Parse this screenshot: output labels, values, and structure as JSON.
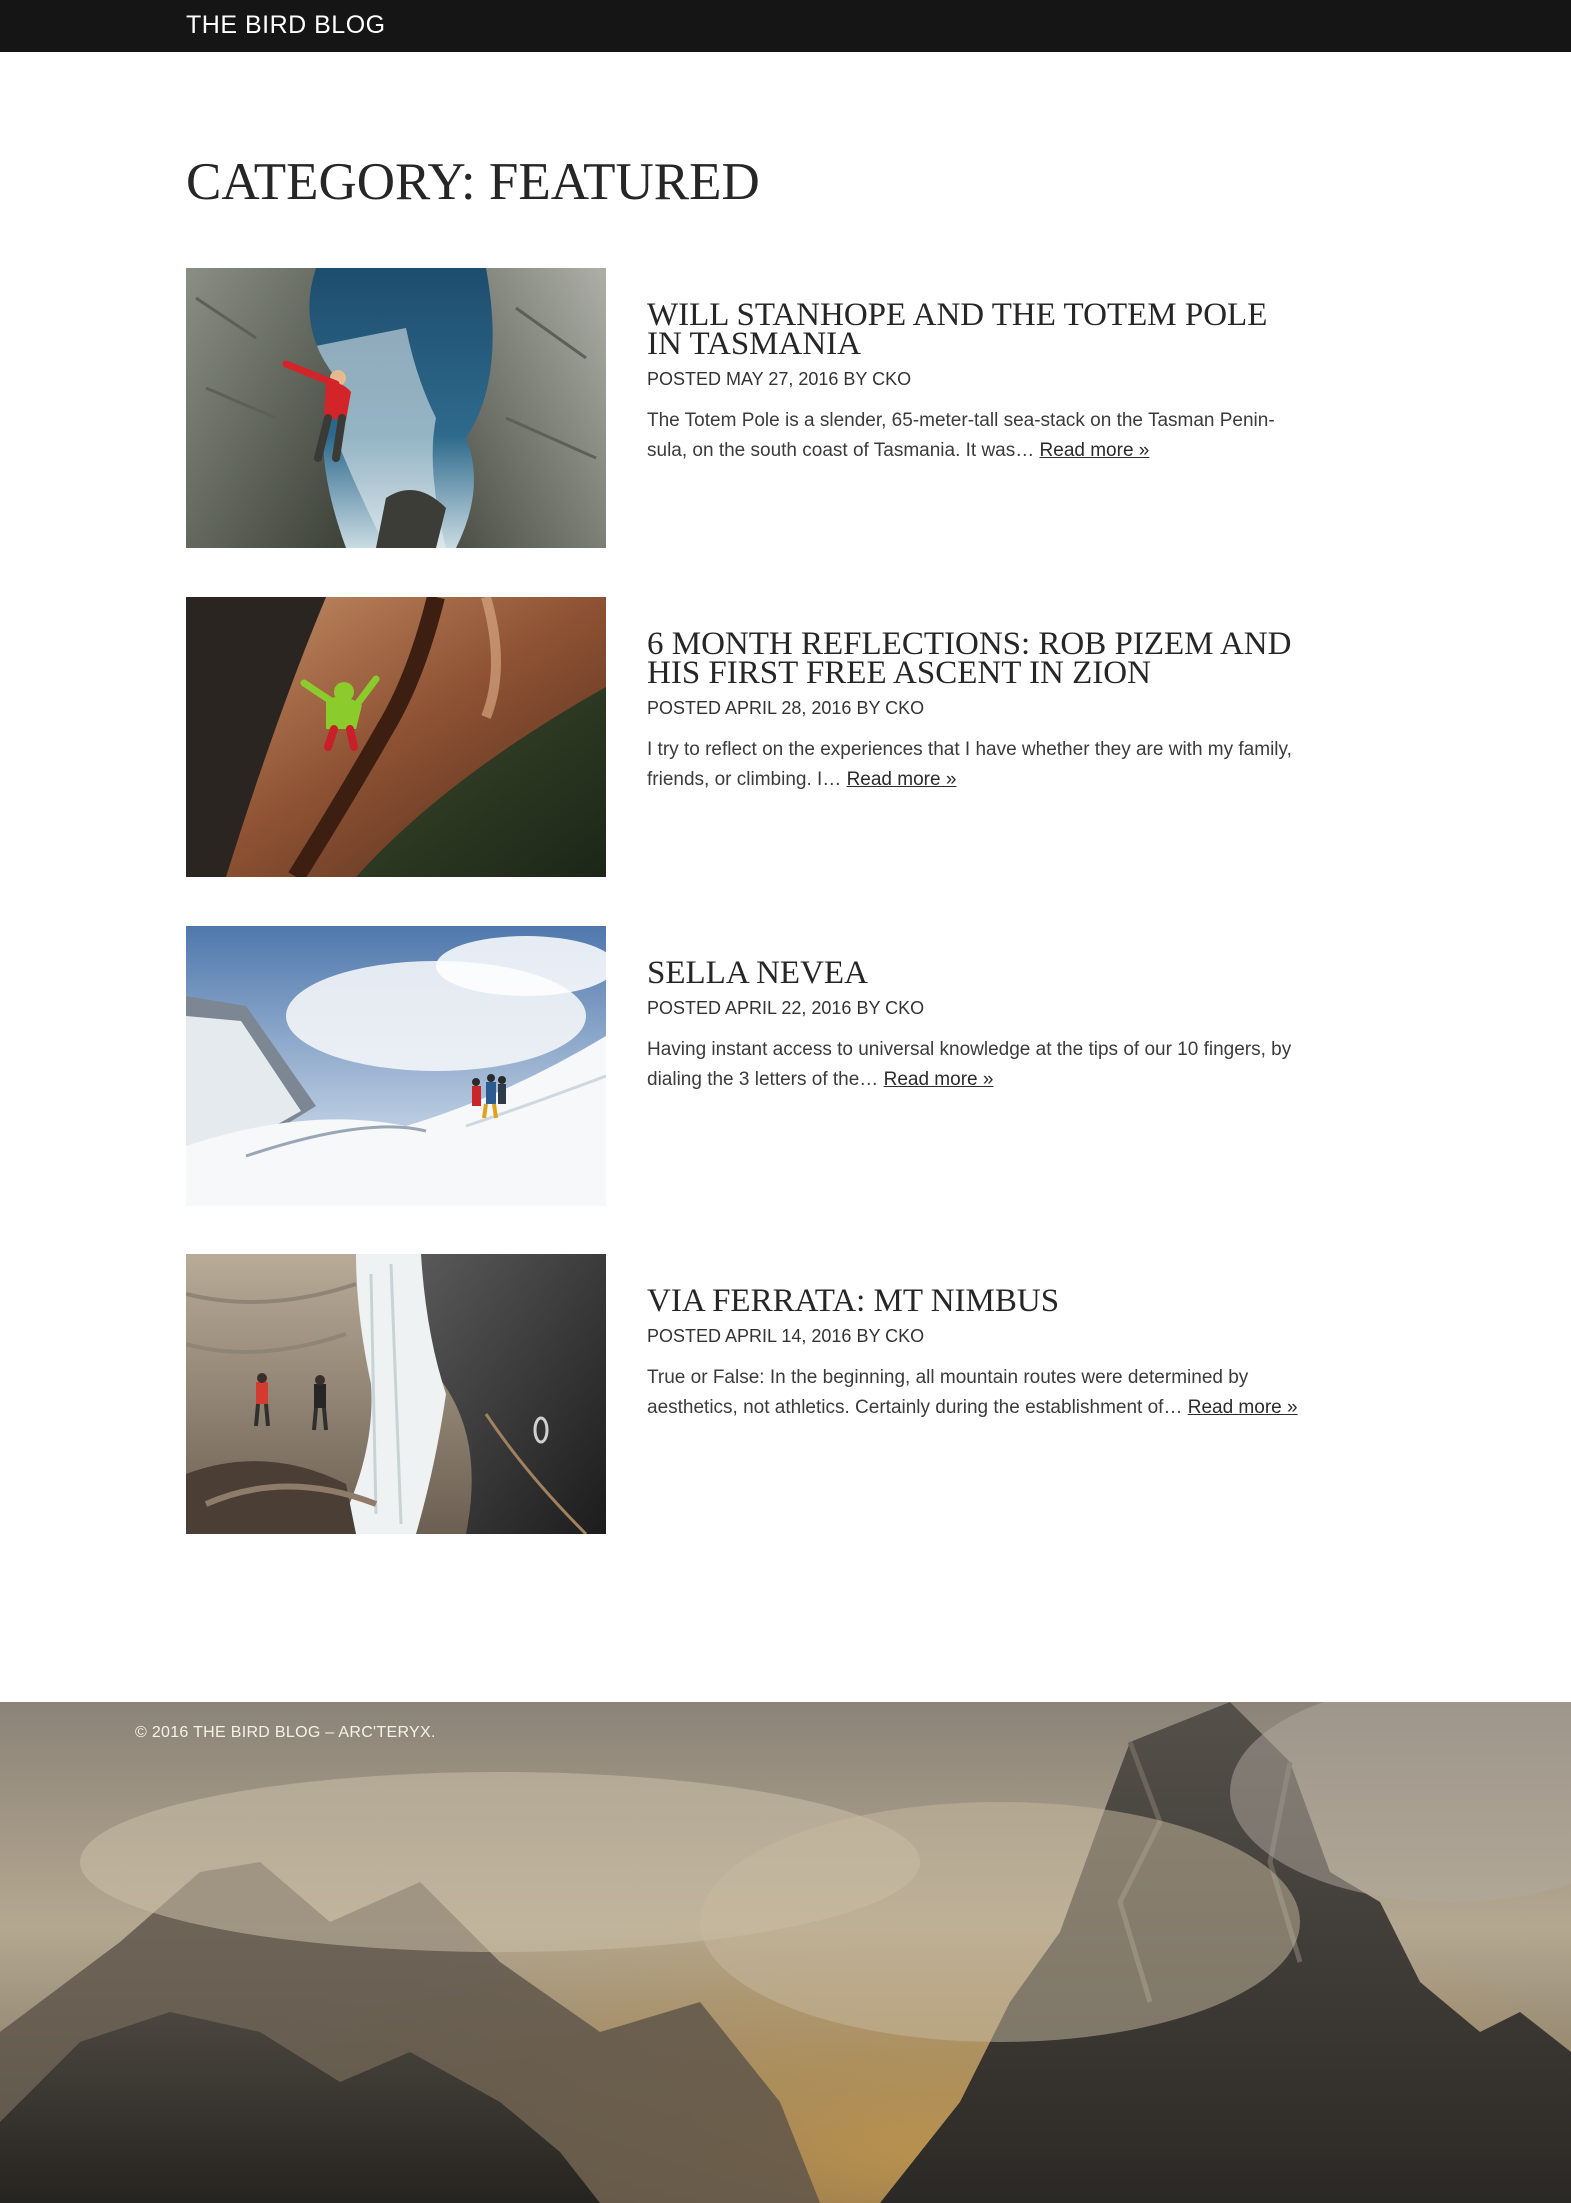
{
  "header": {
    "site_title": "THE BIRD BLOG"
  },
  "page": {
    "title": "CATEGORY: FEATURED"
  },
  "posts": [
    {
      "title": "WILL STANHOPE AND THE TOTEM POLE IN TASMANIA",
      "meta": "POSTED MAY 27, 2016 BY CKO",
      "excerpt": "The Totem Pole is a slender, 65-meter-tall sea-stack on the Tasman Penin-sula, on the south coast of Tasmania. It was… ",
      "read_more": "Read more »",
      "image_alt": "climber in red jacket on sea cliff above ocean"
    },
    {
      "title": "6 MONTH REFLECTIONS: ROB PIZEM AND HIS FIRST FREE ASCENT IN ZION",
      "meta": "POSTED APRIL 28, 2016 BY CKO",
      "excerpt": "I try to reflect on the experiences that I have whether they are with my family, friends, or climbing. I… ",
      "read_more": "Read more »",
      "image_alt": "climber in green jacket on sandstone crack"
    },
    {
      "title": "SELLA NEVEA",
      "meta": "POSTED APRIL 22, 2016 BY CKO",
      "excerpt": "Having instant access to universal knowledge at the tips of our 10 fingers, by dialing the 3 letters of the… ",
      "read_more": "Read more »",
      "image_alt": "mountaineers on a snowy ridge under clouds"
    },
    {
      "title": "VIA FERRATA: MT NIMBUS",
      "meta": "POSTED APRIL 14, 2016 BY CKO",
      "excerpt": "True or False: In the beginning, all mountain routes were determined by aesthetics, not athletics. Certainly during the establishment of… ",
      "read_more": "Read more »",
      "image_alt": "climbers beside a waterfall on a via ferrata"
    }
  ],
  "footer": {
    "copyright": "© 2016 THE BIRD BLOG – ARC'TERYX."
  }
}
